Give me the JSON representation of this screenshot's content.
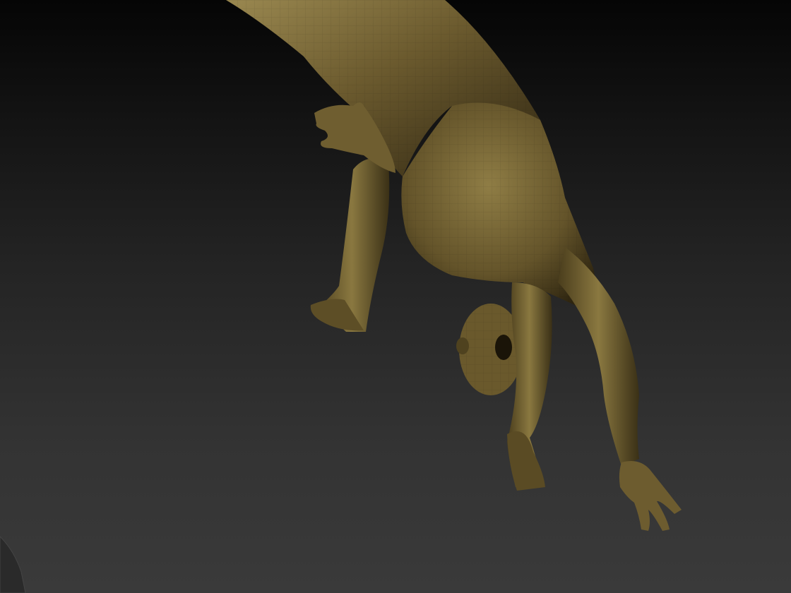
{
  "app": {
    "view": "3d-sculpt-viewport"
  },
  "scene": {
    "background_top": "#050505",
    "background_bottom": "#3a3a3a",
    "material_color": "#6b5a2e",
    "material_highlight": "#9a8850",
    "material_shadow": "#2f2612",
    "model": "humanoid-figure-upside-down",
    "wireframe_polyframe": "visible"
  }
}
